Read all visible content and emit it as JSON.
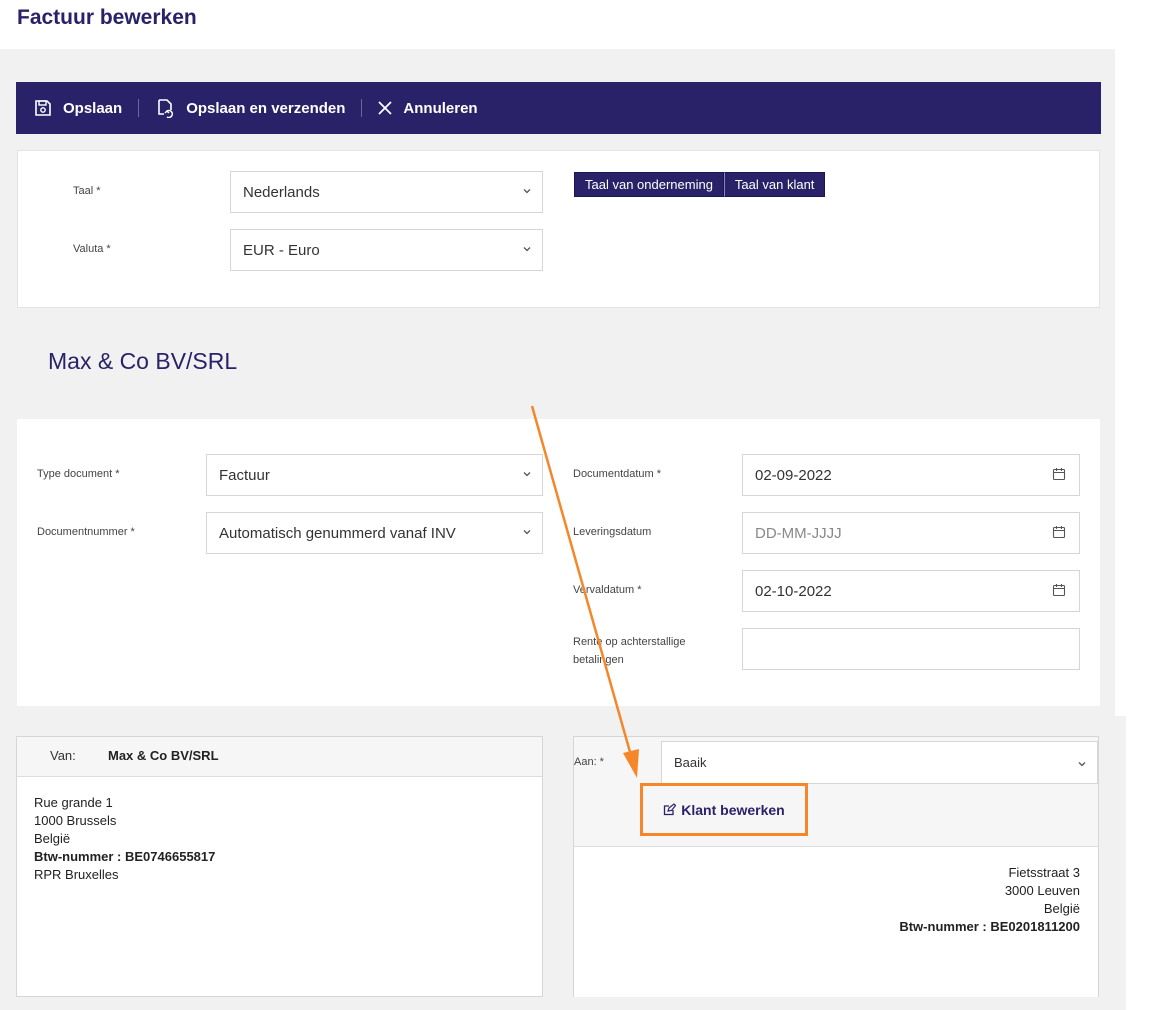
{
  "page_title": "Factuur bewerken",
  "toolbar": {
    "save": "Opslaan",
    "save_send": "Opslaan en verzenden",
    "cancel": "Annuleren"
  },
  "settings": {
    "language_label": "Taal *",
    "language_value": "Nederlands",
    "currency_label": "Valuta *",
    "currency_value": "EUR - Euro",
    "btn_company_lang": "Taal van onderneming",
    "btn_client_lang": "Taal van klant"
  },
  "company_name": "Max & Co BV/SRL",
  "document": {
    "type_label": "Type document *",
    "type_value": "Factuur",
    "number_label": "Documentnummer *",
    "number_value": "Automatisch genummerd vanaf INV",
    "date_label": "Documentdatum *",
    "date_value": "02-09-2022",
    "delivery_label": "Leveringsdatum",
    "delivery_placeholder": "DD-MM-JJJJ",
    "due_label": "Vervaldatum *",
    "due_value": "02-10-2022",
    "interest_label_1": "Rente op achterstallige",
    "interest_label_2": "betalingen"
  },
  "from": {
    "label": "Van:",
    "name": "Max & Co BV/SRL",
    "line1": "Rue grande 1",
    "line2": "1000 Brussels",
    "line3": "België",
    "vat": "Btw-nummer : BE0746655817",
    "line5": "RPR Bruxelles"
  },
  "to": {
    "label": "Aan: *",
    "client": "Baaik",
    "edit_client": "Klant bewerken",
    "line1": "Fietsstraat 3",
    "line2": "3000 Leuven",
    "line3": "België",
    "vat": "Btw-nummer : BE0201811200"
  },
  "colors": {
    "brand": "#2a2268",
    "highlight": "#f5862a"
  }
}
